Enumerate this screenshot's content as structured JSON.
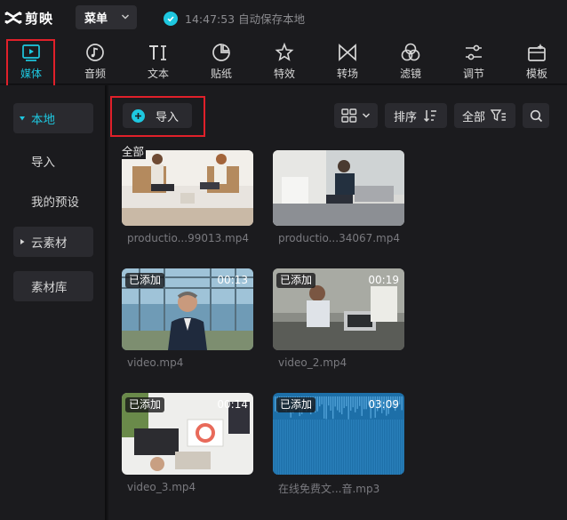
{
  "app": {
    "logo_text": "剪映",
    "menu_label": "菜单",
    "autosave_text": "14:47:53 自动保存本地"
  },
  "toolbar": {
    "items": [
      {
        "label": "媒体",
        "icon": "media-icon",
        "active": true
      },
      {
        "label": "音频",
        "icon": "audio-icon"
      },
      {
        "label": "文本",
        "icon": "text-icon"
      },
      {
        "label": "贴纸",
        "icon": "sticker-icon"
      },
      {
        "label": "特效",
        "icon": "effects-icon"
      },
      {
        "label": "转场",
        "icon": "transition-icon"
      },
      {
        "label": "滤镜",
        "icon": "filter-icon"
      },
      {
        "label": "调节",
        "icon": "adjust-icon"
      },
      {
        "label": "模板",
        "icon": "template-icon"
      }
    ]
  },
  "sidebar": {
    "items": [
      {
        "label": "本地",
        "active": true,
        "expandable": true
      },
      {
        "label": "导入"
      },
      {
        "label": "我的预设"
      },
      {
        "label": "云素材",
        "expandable": true
      },
      {
        "label": "素材库"
      }
    ]
  },
  "main": {
    "import_label": "导入",
    "sort_label": "排序",
    "filter_label": "全部",
    "section_label": "全部",
    "items": [
      {
        "filename": "productio...99013.mp4",
        "badge": "",
        "duration": ""
      },
      {
        "filename": "productio...34067.mp4",
        "badge": "",
        "duration": ""
      },
      {
        "filename": "video.mp4",
        "badge": "已添加",
        "duration": "00:13"
      },
      {
        "filename": "video_2.mp4",
        "badge": "已添加",
        "duration": "00:19"
      },
      {
        "filename": "video_3.mp4",
        "badge": "已添加",
        "duration": "00:14"
      },
      {
        "filename": "在线免费文...音.mp3",
        "badge": "已添加",
        "duration": "03:09"
      }
    ]
  },
  "colors": {
    "accent": "#1ec8e0",
    "highlight": "#e0202a",
    "panel": "#1b1b1e",
    "audio_wave": "#1d6fa8"
  }
}
